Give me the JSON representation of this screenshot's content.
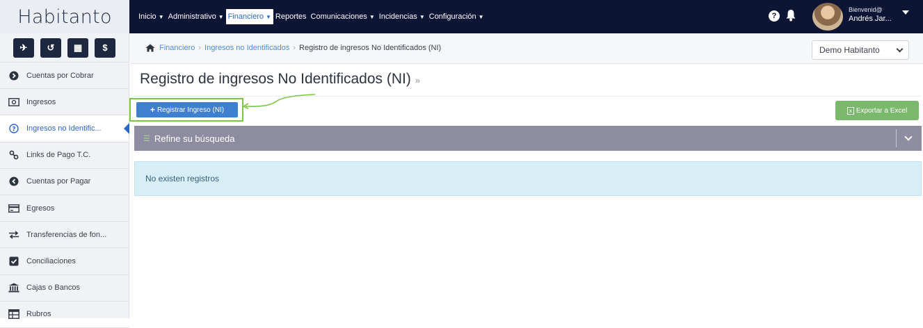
{
  "brand": {
    "name": "Habitanto"
  },
  "nav": {
    "items": [
      {
        "label": "Inicio",
        "active": false
      },
      {
        "label": "Administrativo",
        "active": false
      },
      {
        "label": "Financiero",
        "active": true
      },
      {
        "label": "Reportes",
        "active": false
      },
      {
        "label": "Comunicaciones",
        "active": false
      },
      {
        "label": "Incidencias",
        "active": false
      },
      {
        "label": "Configuración",
        "active": false
      }
    ],
    "help_icon": "question-circle-icon",
    "notification_icon": "bell-icon"
  },
  "user": {
    "greeting": "Bienvenid@",
    "name": "Andrés Jar..."
  },
  "sidebar": {
    "tools": [
      "paper-plane-icon",
      "history-icon",
      "calculator-icon",
      "dollar-icon"
    ],
    "tool_glyphs": [
      "✈",
      "↺",
      "▦",
      "$"
    ],
    "items": [
      {
        "label": "Cuentas por Cobrar",
        "icon": "arrow-circle-right-icon",
        "glyph": "❯",
        "active": false
      },
      {
        "label": "Ingresos",
        "icon": "money-bill-icon",
        "glyph": "▣",
        "active": false
      },
      {
        "label": "Ingresos no Identific...",
        "icon": "question-circle-icon",
        "glyph": "?",
        "active": true
      },
      {
        "label": "Links de Pago T.C.",
        "icon": "link-icon",
        "glyph": "%",
        "active": false
      },
      {
        "label": "Cuentas por Pagar",
        "icon": "arrow-circle-left-icon",
        "glyph": "❮",
        "active": false
      },
      {
        "label": "Egresos",
        "icon": "credit-card-icon",
        "glyph": "▭",
        "active": false
      },
      {
        "label": "Transferencias de fon...",
        "icon": "exchange-icon",
        "glyph": "⇄",
        "active": false
      },
      {
        "label": "Conciliaciones",
        "icon": "check-square-icon",
        "glyph": "✔",
        "active": false
      },
      {
        "label": "Cajas o Bancos",
        "icon": "bank-icon",
        "glyph": "⌂",
        "active": false
      },
      {
        "label": "Rubros",
        "icon": "table-icon",
        "glyph": "▤",
        "active": false
      }
    ]
  },
  "breadcrumb": {
    "items": [
      "Financiero",
      "Ingresos no Identificados"
    ],
    "current": "Registro de ingresos No Identificados (NI)"
  },
  "company_select": {
    "value": "Demo Habitanto"
  },
  "page": {
    "title": "Registro de ingresos No Identificados (NI)",
    "title_suffix": "»"
  },
  "actions": {
    "register_label": "Registrar Ingreso (NI)",
    "export_label": "Exportar a Excel"
  },
  "filter": {
    "label": "Refine su búsqueda"
  },
  "empty_message": "No existen registros",
  "colors": {
    "navbar": "#0d1535",
    "accent_blue": "#3f7fcf",
    "export_green": "#7ab86c",
    "highlight_green": "#7cc444",
    "filter_bar": "#8d8ca1",
    "alert_bg": "#d7eef7"
  }
}
